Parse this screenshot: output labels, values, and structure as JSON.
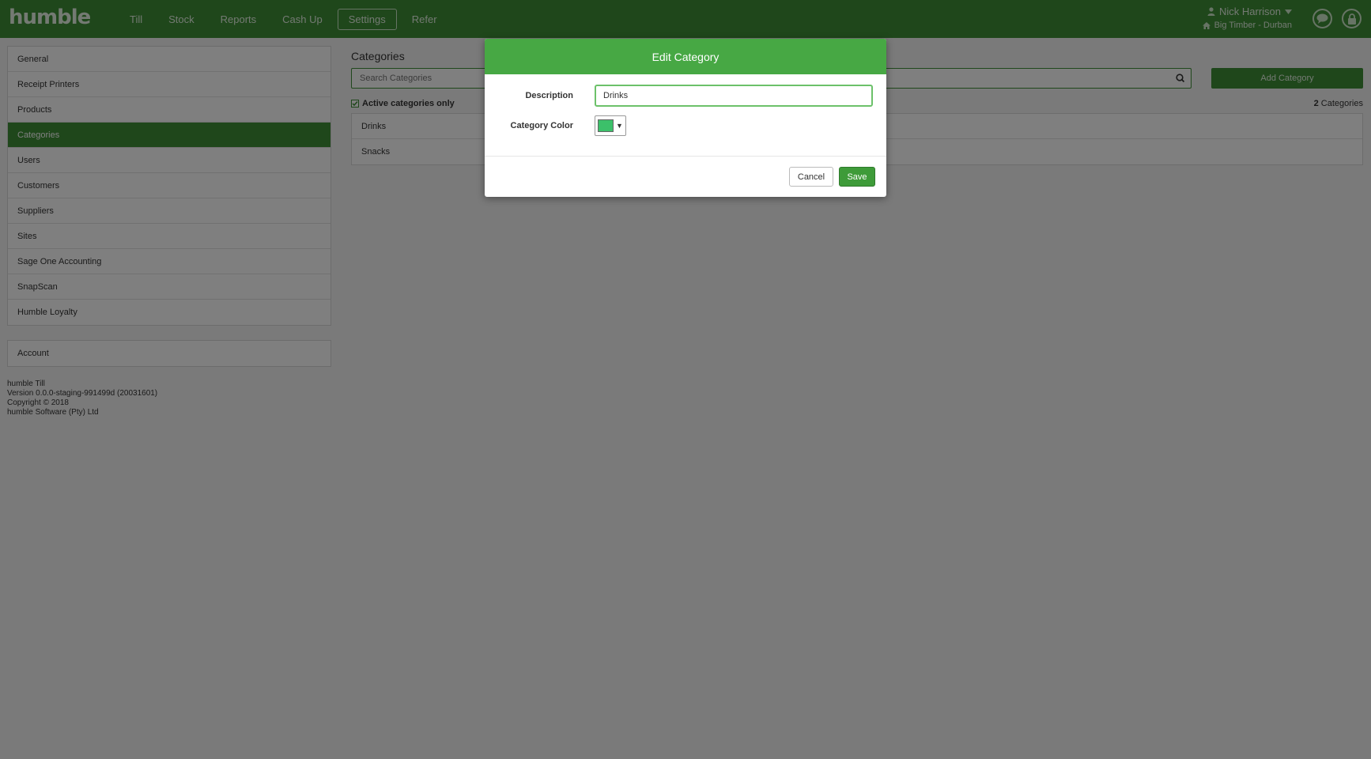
{
  "app": {
    "logo": "humble"
  },
  "nav": {
    "items": [
      {
        "label": "Till"
      },
      {
        "label": "Stock"
      },
      {
        "label": "Reports"
      },
      {
        "label": "Cash Up"
      },
      {
        "label": "Settings"
      },
      {
        "label": "Refer"
      }
    ],
    "active": "Settings"
  },
  "user": {
    "name": "Nick Harrison",
    "site": "Big Timber - Durban"
  },
  "sidebar": {
    "items": [
      {
        "label": "General"
      },
      {
        "label": "Receipt Printers"
      },
      {
        "label": "Products"
      },
      {
        "label": "Categories"
      },
      {
        "label": "Users"
      },
      {
        "label": "Customers"
      },
      {
        "label": "Suppliers"
      },
      {
        "label": "Sites"
      },
      {
        "label": "Sage One Accounting"
      },
      {
        "label": "SnapScan"
      },
      {
        "label": "Humble Loyalty"
      }
    ],
    "active": "Categories",
    "account_label": "Account"
  },
  "version": {
    "line1": "humble Till",
    "line2": "Version 0.0.0-staging-991499d (20031601)",
    "line3": "Copyright © 2018",
    "line4": "humble Software (Pty) Ltd"
  },
  "main": {
    "title": "Categories",
    "search_placeholder": "Search Categories",
    "add_button": "Add Category",
    "active_only_label": "Active categories only",
    "count_value": "2",
    "count_label": "Categories",
    "rows": [
      {
        "label": "Drinks"
      },
      {
        "label": "Snacks"
      }
    ]
  },
  "modal": {
    "title": "Edit Category",
    "description_label": "Description",
    "description_value": "Drinks",
    "color_label": "Category Color",
    "color_value": "#3cc06a",
    "cancel_label": "Cancel",
    "save_label": "Save"
  },
  "colors": {
    "brand": "#3e8e37",
    "modal_header": "#47a844",
    "save_button": "#3e9b39"
  }
}
